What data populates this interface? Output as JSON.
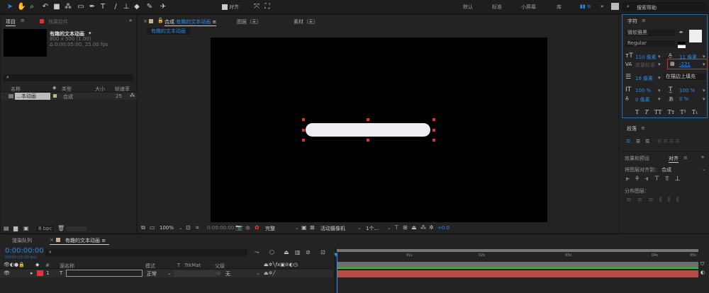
{
  "toolbar": {
    "snap_label": "对齐",
    "workspaces": [
      "默认",
      "标准",
      "小屏幕",
      "库"
    ],
    "search_placeholder": "搜索帮助"
  },
  "project": {
    "tab": "项目",
    "effects_tab": "效果控件",
    "comp_name": "有趣的文本动画",
    "comp_size": "800 x 500 (1.00)",
    "comp_duration": "Δ 0:00:05:00, 25.00 fps",
    "columns": [
      "名称",
      "类型",
      "大小",
      "帧速率"
    ],
    "items": [
      {
        "name": "…本动画",
        "type": "合成",
        "fps": "25"
      }
    ],
    "bpc": "8 bpc"
  },
  "viewer": {
    "comp_tab_prefix": "合成",
    "comp_tab_name": "有趣的文本动画",
    "layer_tab": "图层（无）",
    "footage_tab": "素材（无）",
    "breadcrumb": "有趣的文本动画",
    "zoom": "100%",
    "timecode": "0:00:00:00",
    "resolution": "完整",
    "camera": "活动摄像机",
    "views": "1个...",
    "exposure": "+0.0"
  },
  "character": {
    "title": "字符",
    "font": "微软雅黑",
    "style": "Regular",
    "size": "110 像素",
    "leading": "11 像素",
    "kerning": "度量标准",
    "tracking": "-221",
    "stroke": "18 像素",
    "stroke_mode": "在描边上填充",
    "vscale": "100 %",
    "hscale": "100 %",
    "baseline": "0 像素",
    "tsume": "0 %",
    "styles": [
      "T",
      "T",
      "TT",
      "Tт",
      "T¹",
      "T₁"
    ]
  },
  "paragraph": {
    "title": "段落"
  },
  "align": {
    "tab_effects": "效果和预设",
    "tab_align": "对齐",
    "align_to_label": "将图层对齐到：",
    "align_to": "合成",
    "distribute_label": "分布图层："
  },
  "timeline": {
    "render_tab": "渲染队列",
    "comp_tab": "有趣的文本动画",
    "timecode": "0:00:00:00",
    "frame_info": "00000 (25.00 fps)",
    "columns": {
      "source": "源名称",
      "mode": "模式",
      "t": "T",
      "trkmat": "TrkMat",
      "parent": "父级"
    },
    "layers": [
      {
        "index": "1",
        "type": "T",
        "mode": "正常",
        "parent": "无",
        "label_color": "#d9363e"
      }
    ],
    "ruler": [
      "01s",
      "02s",
      "03s",
      "04s",
      "05s"
    ]
  },
  "colors": {
    "accent": "#2d8ceb",
    "layer_bar": "#b84a4a",
    "work_area": "#22c22a"
  }
}
